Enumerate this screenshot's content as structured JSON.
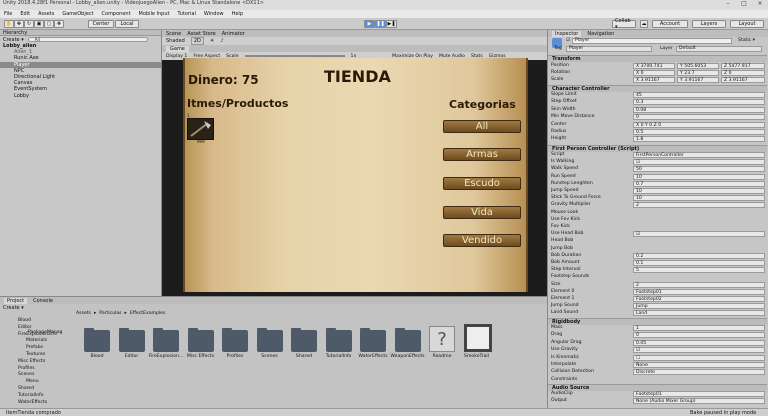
{
  "window": {
    "title": "Unity 2018.4.28f1 Personal - Lobby_alien.unity - VideojuegoAlien - PC, Mac & Linux Standalone <DX11>"
  },
  "menu": [
    "File",
    "Edit",
    "Assets",
    "GameObject",
    "Component",
    "Mobile Input",
    "Tutorial",
    "Window",
    "Help"
  ],
  "toolbar": {
    "pivot": "Center",
    "space": "Local",
    "collab": "Collab ▾",
    "account": "Account",
    "layers": "Layers",
    "layout": "Layout"
  },
  "hierarchy": {
    "tab": "Hierarchy",
    "create": "Create ▾",
    "search": "All",
    "items": [
      "Lobby_alien",
      "Alien_1",
      "Runic Axe",
      "Player",
      "NPC",
      "Directional Light",
      "Canvas",
      "EventSystem",
      "Lobby"
    ]
  },
  "scene": {
    "tab_scene": "Scene",
    "tab_asset": "Asset Store",
    "tab_anim": "Animator",
    "shaded": "Shaded",
    "mode2d": "2D",
    "tab_game": "Game",
    "display": "Display 1",
    "aspect": "Free Aspect",
    "scale": "Scale",
    "scale_val": "1x",
    "maximize": "Maximize On Play",
    "mute": "Mute Audio",
    "stats": "Stats",
    "gizmos": "Gizmos"
  },
  "game": {
    "dinero": "Dinero: 75",
    "titulo": "TIENDA",
    "items_hdr": "Itmes/Productos",
    "item_count": "999",
    "item_slot": "1",
    "categorias": "Categorias",
    "buttons": [
      "All",
      "Armas",
      "Escudo",
      "Vida",
      "Vendido"
    ]
  },
  "project": {
    "tab": "Project",
    "console": "Console",
    "create": "Create ▾",
    "path": [
      "Assets",
      "Particulas",
      "EffectExamples"
    ],
    "tree": [
      "Blood",
      "Editor",
      "FireExplosionEffe",
      "Materials",
      "Prefabs",
      "Textures",
      "Misc Effects",
      "Profiles",
      "Scenes",
      "Menu",
      "Shared",
      "TutorialInfo",
      "WaterEffects"
    ],
    "tree_sub": [
      "PackageManag"
    ],
    "folders": [
      "Blood",
      "Editor",
      "FireExplosion...",
      "Misc Effects",
      "Profiles",
      "Scenes",
      "Shared",
      "TutorialInfo",
      "WaterEffects",
      "WeaponEffects",
      "Readme",
      "SmokeTrail"
    ]
  },
  "inspector": {
    "tab": "Inspector",
    "nav": "Navigation",
    "name": "Player",
    "static": "Static ▾",
    "tag_lbl": "Tag",
    "tag": "Player",
    "layer_lbl": "Layer",
    "layer": "Default",
    "transform": "Transform",
    "position": "Position",
    "pos": [
      "X 3700.741",
      "Y 505.6053",
      "Z 5477.917"
    ],
    "rotation": "Rotation",
    "rot": [
      "X 0",
      "Y 23.7",
      "Z 0"
    ],
    "scale": "Scale",
    "scl": [
      "X 3.91167",
      "Y 3.91167",
      "Z 3.91167"
    ],
    "cc": "Character Controller",
    "cc_rows": [
      [
        "Slope Limit",
        "45"
      ],
      [
        "Step Offset",
        "0.3"
      ],
      [
        "Skin Width",
        "0.08"
      ],
      [
        "Min Move Distance",
        "0"
      ],
      [
        "Center",
        "X 0   Y 0   Z 0"
      ],
      [
        "Radius",
        "0.5"
      ],
      [
        "Height",
        "1.8"
      ]
    ],
    "fpc": "First Person Controller (Script)",
    "fpc_rows": [
      [
        "Script",
        "FirstPersonController"
      ],
      [
        "Is Walking",
        "☑"
      ],
      [
        "Walk Speed",
        "50"
      ],
      [
        "Run Speed",
        "10"
      ],
      [
        "Runstep Lenghten",
        "0.7"
      ],
      [
        "Jump Speed",
        "10"
      ],
      [
        "Stick To Ground Force",
        "10"
      ],
      [
        "Gravity Multiplier",
        "2"
      ],
      [
        "Mouse Look",
        ""
      ],
      [
        "Use Fov Kick",
        ""
      ],
      [
        "Fov Kick",
        ""
      ],
      [
        "Use Head Bob",
        "☑"
      ],
      [
        "Head Bob",
        ""
      ],
      [
        "Jump Bob",
        ""
      ],
      [
        "Bob Duration",
        "0.2"
      ],
      [
        "Bob Amount",
        "0.1"
      ],
      [
        "Step Interval",
        "5"
      ],
      [
        "Footstep Sounds",
        ""
      ],
      [
        "Size",
        "2"
      ],
      [
        "Element 0",
        "Footstep01"
      ],
      [
        "Element 1",
        "Footstep02"
      ],
      [
        "Jump Sound",
        "Jump"
      ],
      [
        "Land Sound",
        "Land"
      ]
    ],
    "rb": "Rigidbody",
    "rb_rows": [
      [
        "Mass",
        "1"
      ],
      [
        "Drag",
        "0"
      ],
      [
        "Angular Drag",
        "0.05"
      ],
      [
        "Use Gravity",
        "☑"
      ],
      [
        "Is Kinematic",
        "☐"
      ],
      [
        "Interpolate",
        "None"
      ],
      [
        "Collision Detection",
        "Discrete"
      ],
      [
        "Constraints",
        ""
      ]
    ],
    "audio": "Audio Source",
    "audio_rows": [
      [
        "AudioClip",
        "Footstep01"
      ],
      [
        "Output",
        "None (Audio Mixer Group)"
      ]
    ]
  },
  "status": {
    "left": "ItemTienda comprado",
    "right": "Bake paused in play mode"
  }
}
